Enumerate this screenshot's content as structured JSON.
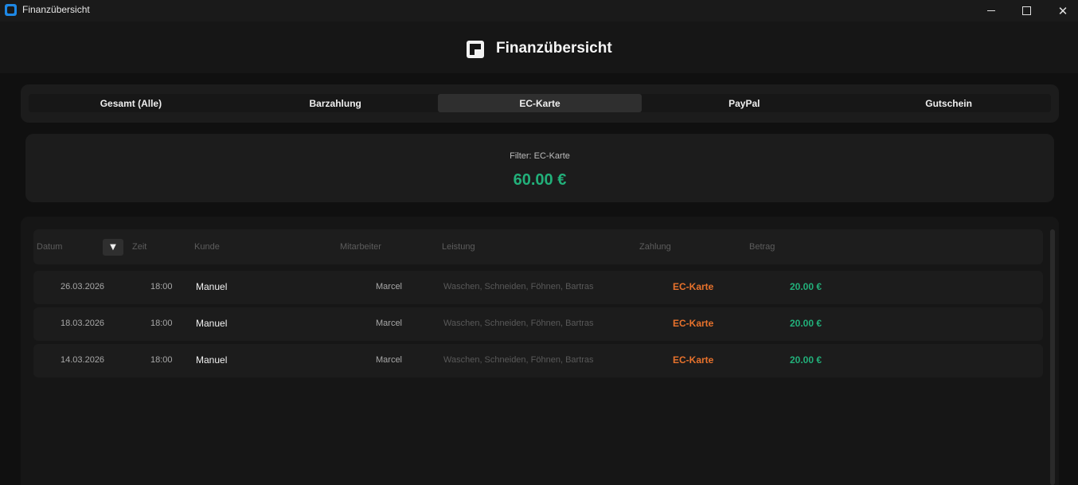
{
  "window": {
    "title": "Finanzübersicht",
    "close_glyph": "✕"
  },
  "header": {
    "title": "Finanzübersicht",
    "icon": "ledger-icon"
  },
  "tabs": [
    {
      "label": "Gesamt (Alle)",
      "active": false
    },
    {
      "label": "Barzahlung",
      "active": false
    },
    {
      "label": "EC-Karte",
      "active": true
    },
    {
      "label": "PayPal",
      "active": false
    },
    {
      "label": "Gutschein",
      "active": false
    }
  ],
  "summary": {
    "filter_label": "Filter: EC-Karte",
    "total": "60.00 €"
  },
  "table": {
    "sort_glyph": "▼",
    "columns": {
      "datum": "Datum",
      "zeit": "Zeit",
      "kunde": "Kunde",
      "mitarbeiter": "Mitarbeiter",
      "leistung": "Leistung",
      "zahlung": "Zahlung",
      "betrag": "Betrag"
    },
    "rows": [
      {
        "datum": "26.03.2026",
        "zeit": "18:00",
        "kunde": "Manuel",
        "mitarbeiter": "Marcel",
        "leistung": "Waschen, Schneiden, Föhnen, Bartras",
        "zahlung": "EC-Karte",
        "betrag": "20.00 €"
      },
      {
        "datum": "18.03.2026",
        "zeit": "18:00",
        "kunde": "Manuel",
        "mitarbeiter": "Marcel",
        "leistung": "Waschen, Schneiden, Föhnen, Bartras",
        "zahlung": "EC-Karte",
        "betrag": "20.00 €"
      },
      {
        "datum": "14.03.2026",
        "zeit": "18:00",
        "kunde": "Manuel",
        "mitarbeiter": "Marcel",
        "leistung": "Waschen, Schneiden, Föhnen, Bartras",
        "zahlung": "EC-Karte",
        "betrag": "20.00 €"
      }
    ]
  },
  "colors": {
    "accent_green": "#22b07a",
    "accent_orange": "#e8722c",
    "background": "#101010"
  }
}
